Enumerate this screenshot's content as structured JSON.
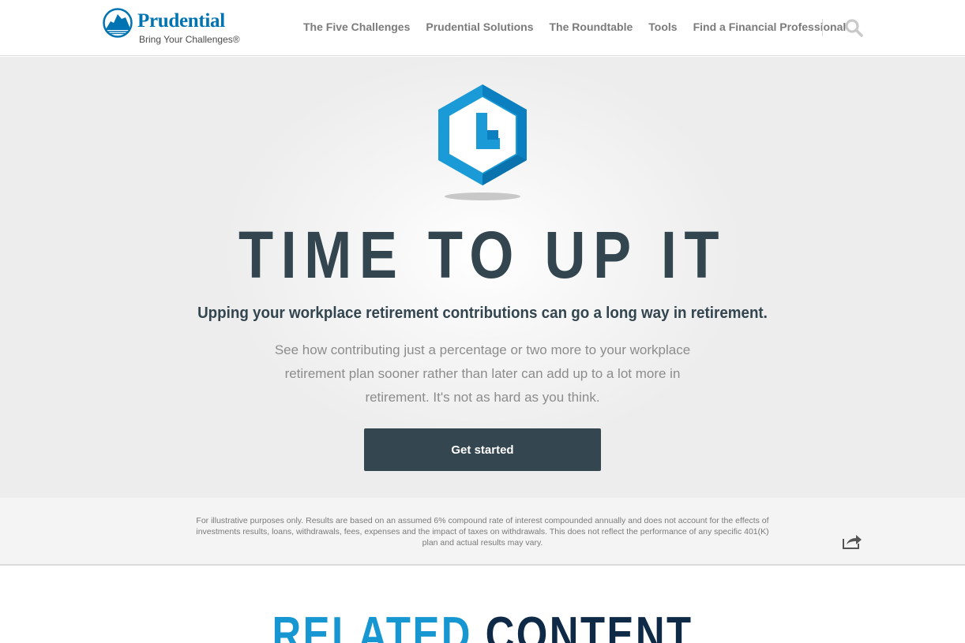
{
  "header": {
    "logo": {
      "name": "Prudential",
      "tagline": "Bring Your Challenges®"
    },
    "nav": [
      {
        "label": "The Five Challenges"
      },
      {
        "label": "Prudential Solutions"
      },
      {
        "label": "The Roundtable"
      },
      {
        "label": "Tools"
      },
      {
        "label": "Find a Financial Professional"
      }
    ],
    "search_icon": "search-icon"
  },
  "hero": {
    "icon": "hexagon-clock-icon",
    "title": "TIME TO UP IT",
    "subtitle": "Upping your workplace retirement contributions can go a long way in retirement.",
    "body": "See how contributing just a percentage or two more to your workplace retirement plan sooner rather than later can add up to a lot more in retirement. It's not as hard as you think.",
    "cta_label": "Get started"
  },
  "disclaimer": {
    "text": "For illustrative purposes only. Results are based on an assumed 6% compound rate of interest compounded annually and does not account for the effects of investments results, loans, withdrawals, fees, expenses and the impact of taxes on withdrawals. This does not reflect the performance of any specific 401(K) plan and actual results may vary.",
    "share_icon": "share-icon"
  },
  "related": {
    "heading_part1": "RELATED",
    "heading_part2": "CONTENT"
  },
  "colors": {
    "brand_blue": "#0073b3",
    "accent_blue": "#1797d2",
    "navy": "#0f2a47",
    "slate": "#33454e",
    "button": "#34464f"
  }
}
